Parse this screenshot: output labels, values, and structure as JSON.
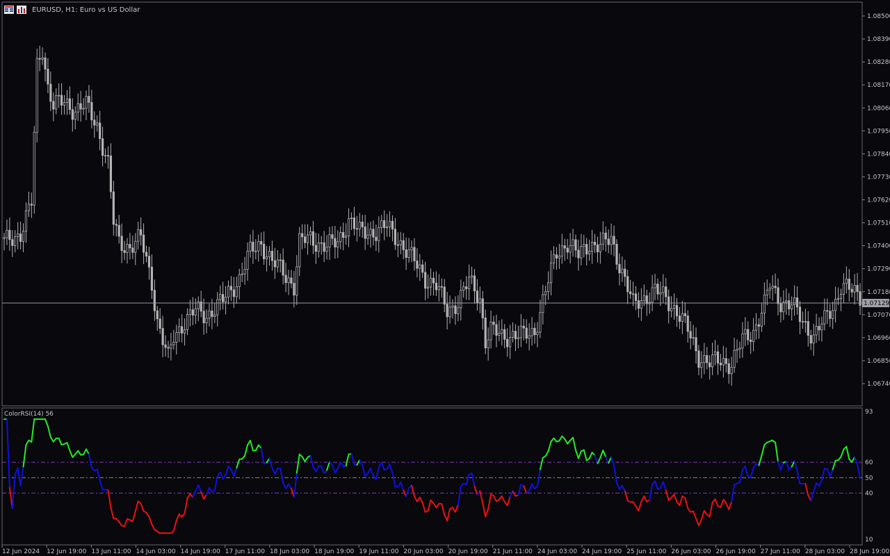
{
  "header": {
    "icon_menu": "menu-grid-icon",
    "icon_chart": "chart-type-icon",
    "title": "EURUSD, H1:  Euro vs US Dollar"
  },
  "rsi_panel": {
    "title": "ColorRSI(14) 56",
    "levels": [
      "93",
      "60",
      "50",
      "40",
      "10"
    ]
  },
  "price_axis": {
    "labels": [
      "1.08500",
      "1.08390",
      "1.08280",
      "1.08170",
      "1.08060",
      "1.07950",
      "1.07840",
      "1.07730",
      "1.07620",
      "1.07510",
      "1.07400",
      "1.07290",
      "1.07180",
      "1.07070",
      "1.06960",
      "1.06850",
      "1.06740"
    ],
    "current_price": "1.07129"
  },
  "time_axis": {
    "labels": [
      "12 Jun 2024",
      "12 Jun 19:00",
      "13 Jun 11:00",
      "14 Jun 03:00",
      "14 Jun 19:00",
      "17 Jun 11:00",
      "18 Jun 03:00",
      "18 Jun 19:00",
      "19 Jun 11:00",
      "20 Jun 03:00",
      "20 Jun 19:00",
      "21 Jun 11:00",
      "24 Jun 03:00",
      "24 Jun 19:00",
      "25 Jun 11:00",
      "26 Jun 03:00",
      "26 Jun 19:00",
      "27 Jun 11:00",
      "28 Jun 03:00",
      "28 Jun 19:00"
    ]
  },
  "colors": {
    "background": "#08080d",
    "candle": "#b4b4b4",
    "rsi_up": "#22ee22",
    "rsi_neutral": "#1010e0",
    "rsi_down": "#ee1010",
    "level_line": "#8833cc",
    "mid_line": "#888888",
    "current_line": "#9a9aa8"
  },
  "chart_data": {
    "type": "candlestick",
    "symbol": "EURUSD",
    "timeframe": "H1",
    "price_range": [
      1.0665,
      1.0857
    ],
    "current_price": 1.07129,
    "close_anchors": [
      [
        0,
        1.074
      ],
      [
        6,
        1.0745
      ],
      [
        10,
        1.076
      ],
      [
        12,
        1.083
      ],
      [
        14,
        1.084
      ],
      [
        16,
        1.082
      ],
      [
        18,
        1.081
      ],
      [
        22,
        1.0812
      ],
      [
        26,
        1.0808
      ],
      [
        30,
        1.081
      ],
      [
        34,
        1.08
      ],
      [
        38,
        1.078
      ],
      [
        40,
        1.075
      ],
      [
        42,
        1.074
      ],
      [
        46,
        1.0738
      ],
      [
        50,
        1.0742
      ],
      [
        54,
        1.072
      ],
      [
        56,
        1.07
      ],
      [
        58,
        1.069
      ],
      [
        60,
        1.068
      ],
      [
        62,
        1.0692
      ],
      [
        66,
        1.07
      ],
      [
        70,
        1.0705
      ],
      [
        74,
        1.0703
      ],
      [
        80,
        1.071
      ],
      [
        86,
        1.0722
      ],
      [
        90,
        1.0735
      ],
      [
        94,
        1.074
      ],
      [
        98,
        1.073
      ],
      [
        102,
        1.0725
      ],
      [
        106,
        1.0718
      ],
      [
        108,
        1.074
      ],
      [
        112,
        1.0742
      ],
      [
        118,
        1.0738
      ],
      [
        122,
        1.074
      ],
      [
        126,
        1.0752
      ],
      [
        130,
        1.0745
      ],
      [
        136,
        1.0746
      ],
      [
        140,
        1.0748
      ],
      [
        144,
        1.0742
      ],
      [
        150,
        1.073
      ],
      [
        154,
        1.0722
      ],
      [
        158,
        1.0718
      ],
      [
        162,
        1.0705
      ],
      [
        166,
        1.071
      ],
      [
        170,
        1.072
      ],
      [
        174,
        1.0712
      ],
      [
        176,
        1.069
      ],
      [
        178,
        1.0695
      ],
      [
        182,
        1.0692
      ],
      [
        186,
        1.0693
      ],
      [
        190,
        1.0692
      ],
      [
        194,
        1.0695
      ],
      [
        198,
        1.0715
      ],
      [
        202,
        1.0735
      ],
      [
        206,
        1.074
      ],
      [
        210,
        1.0733
      ],
      [
        214,
        1.074
      ],
      [
        218,
        1.0738
      ],
      [
        222,
        1.0742
      ],
      [
        226,
        1.0725
      ],
      [
        230,
        1.0708
      ],
      [
        234,
        1.0712
      ],
      [
        238,
        1.0715
      ],
      [
        242,
        1.0712
      ],
      [
        246,
        1.0705
      ],
      [
        250,
        1.0695
      ],
      [
        254,
        1.0682
      ],
      [
        258,
        1.0678
      ],
      [
        262,
        1.068
      ],
      [
        266,
        1.0678
      ],
      [
        270,
        1.069
      ],
      [
        274,
        1.0695
      ],
      [
        278,
        1.0708
      ],
      [
        280,
        1.0718
      ],
      [
        284,
        1.071
      ],
      [
        288,
        1.0708
      ],
      [
        292,
        1.07
      ],
      [
        296,
        1.0692
      ],
      [
        300,
        1.07
      ],
      [
        304,
        1.071
      ],
      [
        306,
        1.0718
      ],
      [
        310,
        1.0715
      ],
      [
        313,
        1.0713
      ]
    ],
    "rsi": {
      "name": "ColorRSI(14)",
      "last_value": 56,
      "range": [
        10,
        93
      ],
      "levels": [
        40,
        50,
        60
      ]
    }
  }
}
